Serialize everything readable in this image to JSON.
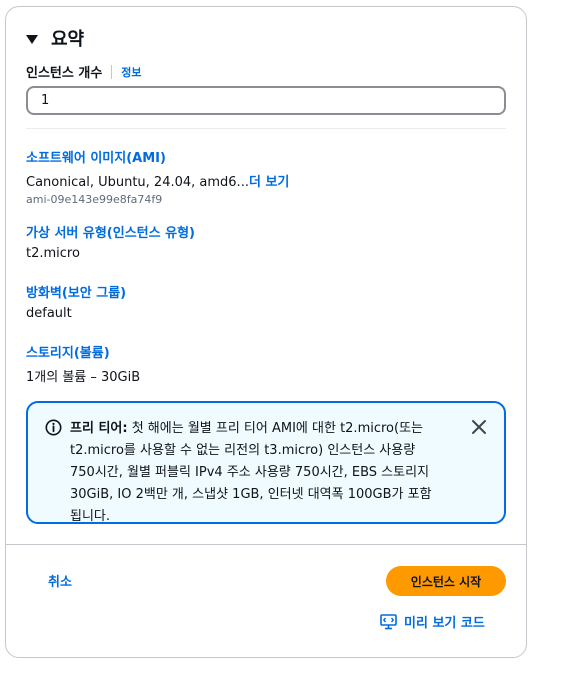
{
  "summary": {
    "title": "요약",
    "instance_count": {
      "label": "인스턴스 개수",
      "info_link": "정보",
      "value": "1"
    },
    "ami": {
      "label": "소프트웨어 이미지(AMI)",
      "value": "Canonical, Ubuntu, 24.04, amd6...",
      "more_link": "더 보기",
      "id": "ami-09e143e99e8fa74f9"
    },
    "instance_type": {
      "label": "가상 서버 유형(인스턴스 유형)",
      "value": "t2.micro"
    },
    "firewall": {
      "label": "방화벽(보안 그룹)",
      "value": "default"
    },
    "storage": {
      "label": "스토리지(볼륨)",
      "value": "1개의 볼륨 – 30GiB"
    },
    "free_tier_alert": {
      "heading": "프리 티어:",
      "body": "첫 해에는 월별 프리 티어 AMI에 대한 t2.micro(또는 t2.micro를 사용할 수 없는 리전의 t3.micro) 인스턴스 사용량 750시간, 월별 퍼블릭 IPv4 주소 사용량 750시간, EBS 스토리지 30GiB, IO 2백만 개, 스냅샷 1GB, 인터넷 대역폭 100GB가 포함됩니다.",
      "icon": "info-icon",
      "close_icon": "close-icon"
    },
    "actions": {
      "cancel_label": "취소",
      "launch_label": "인스턴스 시작",
      "preview_label": "미리 보기 코드",
      "preview_icon": "code-preview-icon"
    }
  },
  "colors": {
    "link": "#006ce0",
    "primary_button": "#ff9900",
    "alert_border": "#006ce0",
    "alert_background": "#f0fbff"
  }
}
